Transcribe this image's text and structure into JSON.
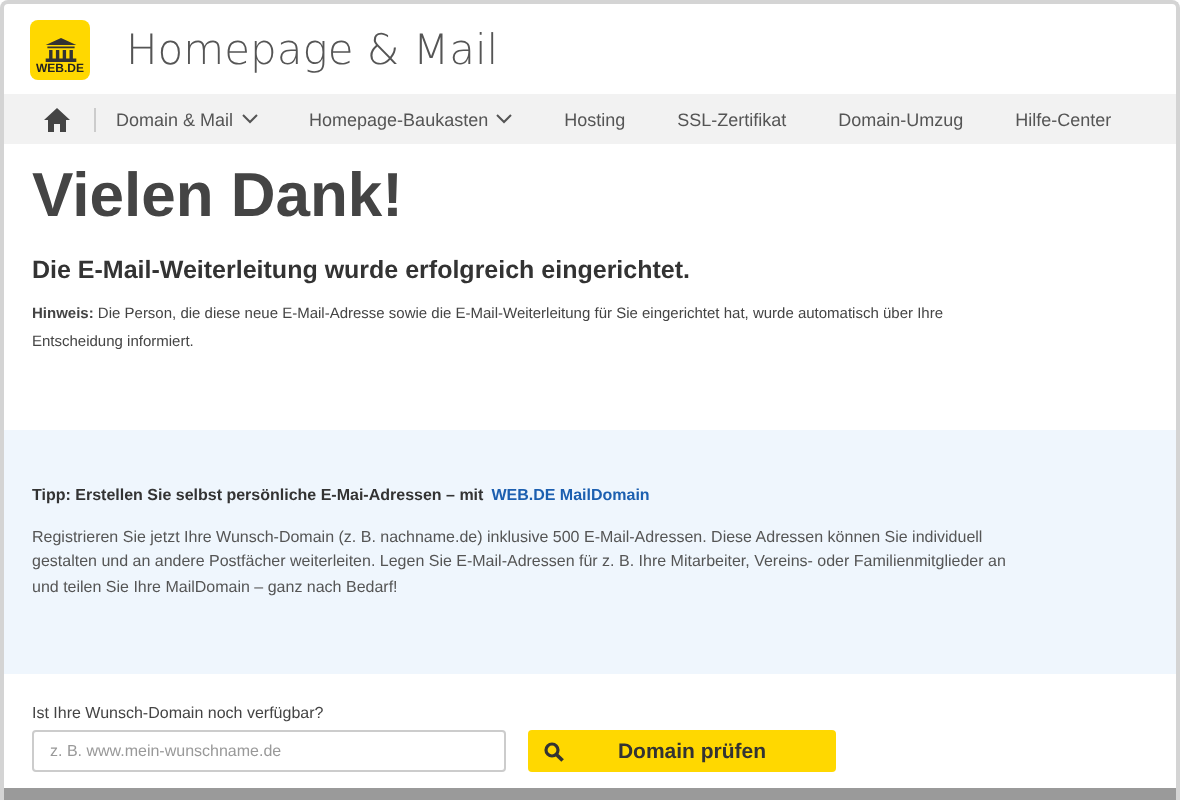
{
  "header": {
    "logo_text": "WEB.DE",
    "title": "Homepage & Mail"
  },
  "nav": [
    {
      "label": "Domain & Mail",
      "kind": "dropdown"
    },
    {
      "label": "Homepage-Baukasten",
      "kind": "dropdown"
    },
    {
      "label": "Hosting",
      "kind": "link"
    },
    {
      "label": "SSL-Zertifikat",
      "kind": "link"
    },
    {
      "label": "Domain-Umzug",
      "kind": "link"
    },
    {
      "label": "Hilfe-Center",
      "kind": "link"
    }
  ],
  "heading": "Vielen Dank!",
  "subheading": "Die E-Mail-Weiterleitung wurde erfolgreich eingerichtet.",
  "note": "**Hinweis:** Die Person, die diese neue E-Mail-Adresse sowie die E-Mail-Weiterleitung für Sie eingerichtet hat, wurde automatisch über Ihre Entscheidung informiert.",
  "tip": {
    "text": "Tipp: Erstellen Sie selbst persönliche E-Mai-Adressen – mit",
    "link": "WEB.DE MailDomain",
    "body": "Registrieren Sie jetzt Ihre Wunsch-Domain (z. B. nachname.de) inklusive 500 E-Mail-Adressen. Diese Adressen können Sie individuell gestalten und an andere Postfächer weiterleiten. Legen Sie E-Mail-Adressen für z. B. Ihre Mitarbeiter, Vereins- oder Familienmitglieder an und teilen Sie Ihre MailDomain – ganz nach Bedarf!"
  },
  "domain_check": {
    "label": "Ist Ihre Wunsch-Domain noch verfügbar?",
    "placeholder": "z. B. www.mein-wunschname.de",
    "button": "Domain prüfen"
  }
}
